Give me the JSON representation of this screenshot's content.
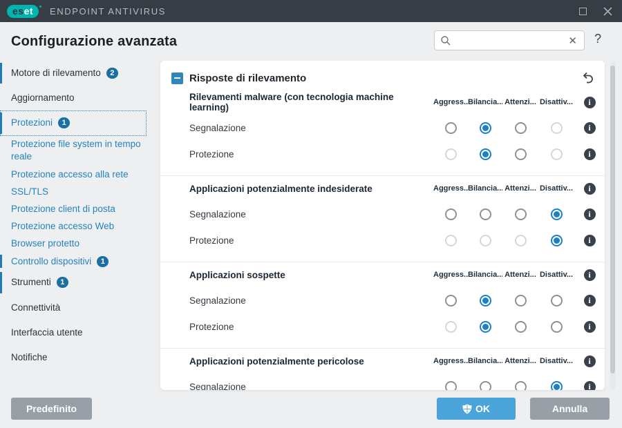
{
  "titlebar": {
    "logo_es": "es",
    "logo_et": "et",
    "app_name": "ENDPOINT ANTIVIRUS"
  },
  "header": {
    "title": "Configurazione avanzata",
    "search_value": "",
    "help_label": "?"
  },
  "sidebar": {
    "items": [
      {
        "label": "Motore di rilevamento",
        "badge": "2",
        "style": "top",
        "color": "dark",
        "bar": true,
        "selected": false
      },
      {
        "label": "Aggiornamento",
        "badge": "",
        "style": "top",
        "color": "dark",
        "bar": false,
        "selected": false
      },
      {
        "label": "Protezioni",
        "badge": "1",
        "style": "top",
        "color": "blue",
        "bar": true,
        "selected": true
      },
      {
        "label": "Protezione file system in tempo reale",
        "badge": "",
        "style": "sub",
        "color": "blue",
        "bar": false,
        "selected": false
      },
      {
        "label": "Protezione accesso alla rete",
        "badge": "",
        "style": "sub",
        "color": "blue",
        "bar": false,
        "selected": false
      },
      {
        "label": "SSL/TLS",
        "badge": "",
        "style": "sub",
        "color": "blue",
        "bar": false,
        "selected": false
      },
      {
        "label": "Protezione client di posta",
        "badge": "",
        "style": "sub",
        "color": "blue",
        "bar": false,
        "selected": false
      },
      {
        "label": "Protezione accesso Web",
        "badge": "",
        "style": "sub",
        "color": "blue",
        "bar": false,
        "selected": false
      },
      {
        "label": "Browser protetto",
        "badge": "",
        "style": "sub",
        "color": "blue",
        "bar": false,
        "selected": false
      },
      {
        "label": "Controllo dispositivi",
        "badge": "1",
        "style": "sub",
        "color": "blue",
        "bar": true,
        "selected": false
      },
      {
        "label": "Strumenti",
        "badge": "1",
        "style": "top",
        "color": "dark",
        "bar": true,
        "selected": false
      },
      {
        "label": "Connettività",
        "badge": "",
        "style": "top",
        "color": "dark",
        "bar": false,
        "selected": false
      },
      {
        "label": "Interfaccia utente",
        "badge": "",
        "style": "top",
        "color": "dark",
        "bar": false,
        "selected": false
      },
      {
        "label": "Notifiche",
        "badge": "",
        "style": "top",
        "color": "dark",
        "bar": false,
        "selected": false
      }
    ]
  },
  "panel": {
    "title": "Risposte di rilevamento",
    "column_headers": [
      "Aggress...",
      "Bilancia...",
      "Attenzi...",
      "Disattiv..."
    ],
    "info_glyph": "i",
    "sections": [
      {
        "title": "Rilevamenti malware (con tecnologia machine learning)",
        "rows": [
          {
            "label": "Segnalazione",
            "states": [
              "normal",
              "selected",
              "normal",
              "disabled"
            ]
          },
          {
            "label": "Protezione",
            "states": [
              "disabled",
              "selected",
              "normal",
              "disabled"
            ]
          }
        ]
      },
      {
        "title": "Applicazioni potenzialmente indesiderate",
        "rows": [
          {
            "label": "Segnalazione",
            "states": [
              "normal",
              "normal",
              "normal",
              "selected"
            ]
          },
          {
            "label": "Protezione",
            "states": [
              "disabled",
              "disabled",
              "disabled",
              "selected"
            ]
          }
        ]
      },
      {
        "title": "Applicazioni sospette",
        "rows": [
          {
            "label": "Segnalazione",
            "states": [
              "normal",
              "selected",
              "normal",
              "normal"
            ]
          },
          {
            "label": "Protezione",
            "states": [
              "disabled",
              "selected",
              "normal",
              "normal"
            ]
          }
        ]
      },
      {
        "title": "Applicazioni potenzialmente pericolose",
        "rows": [
          {
            "label": "Segnalazione",
            "states": [
              "normal",
              "normal",
              "normal",
              "selected"
            ]
          }
        ]
      }
    ]
  },
  "footer": {
    "default_label": "Predefinito",
    "ok_label": "OK",
    "cancel_label": "Annulla"
  },
  "colors": {
    "titlebar": "#363d45",
    "teal": "#00b5ad",
    "accent_blue": "#1b80c4",
    "sidebar_blue_text": "#2583ba",
    "badge": "#1a6fa3",
    "ok_button": "#4ba4d9",
    "gray_button": "#999fa6",
    "info_icon": "#39424c"
  }
}
